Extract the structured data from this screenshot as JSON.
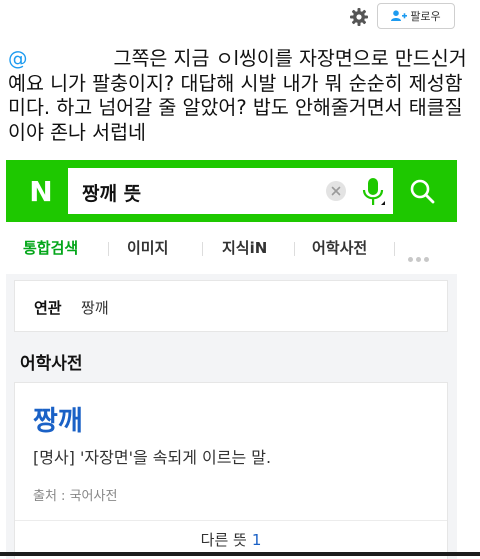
{
  "topbar": {
    "follow_label": "팔로우"
  },
  "tweet": {
    "mention": "@",
    "body": "그쪽은 지금 ㅇl씽이를 자장면으로 만드신거예요 니가 팔충이지? 대답해 시발 내가 뭐 순순히 제성함미다. 하고 넘어갈 줄 알았어? 밥도 안해줄거면서 태클질이야 존나 서럽네"
  },
  "naver": {
    "logo": "N",
    "query": "짱깨 뜻",
    "tabs": [
      "통합검색",
      "이미지",
      "지식iN",
      "어학사전"
    ],
    "related": {
      "label": "연관",
      "term": "짱깨"
    },
    "section_title": "어학사전",
    "entry": {
      "word": "짱깨",
      "definition": "[명사] '자장면'을 속되게 이르는 말.",
      "source": "출처 : 국어사전",
      "more_label": "다른 뜻",
      "more_count": "1"
    }
  },
  "colors": {
    "naver_green": "#1ec800",
    "active_tab": "#03a619",
    "link_blue": "#1a61c6",
    "mention_blue": "#1d9bf0"
  },
  "icons": [
    "gear-icon",
    "add-user-icon",
    "clear-icon",
    "microphone-icon",
    "search-icon",
    "more-icon"
  ]
}
